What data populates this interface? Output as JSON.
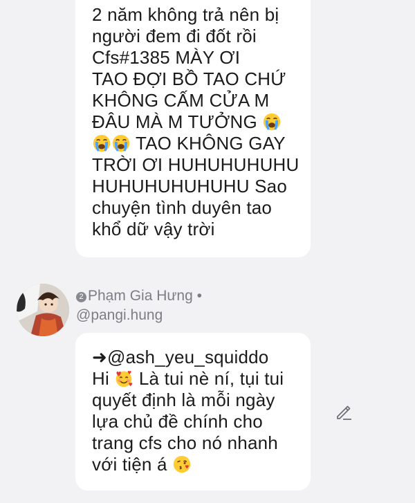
{
  "top_comment": {
    "lines": [
      "2 năm không trả nên bị",
      "người đem đi đốt rồi",
      "Cfs#1385 MÀY ƠI",
      "TAO ĐỢI BỒ TAO CHỨ",
      "KHÔNG CẤM CỬA M",
      "ĐÂU MÀ M TƯỞNG",
      "TAO KHÔNG GAY",
      "TRỜI ƠI HUHUHUHUHU",
      "HUHUHUHUHUHU Sao",
      "chuyện tình duyên tao",
      "khổ dữ vậy trời"
    ]
  },
  "reply": {
    "author_badge": "2",
    "author_name": "Phạm Gia Hưng",
    "author_separator": "•",
    "handle": "@pangi.hung",
    "mention_arrow": "➜",
    "mention": "@ash_yeu_squiddo",
    "line_hi": "Hi",
    "line_hi_rest": "Là tui nè ní, tụi tui",
    "lines": [
      "quyết định là mỗi ngày",
      "lựa chủ đề chính cho",
      "trang cfs cho nó nhanh"
    ],
    "last_line": "với tiện á"
  },
  "icons": {
    "crying": "loudly-crying-face-emoji",
    "hearts": "smiling-face-with-hearts-emoji",
    "kiss": "face-blowing-kiss-emoji",
    "edit": "pencil-edit-icon"
  },
  "colors": {
    "background": "#f2f2f4",
    "bubble": "#ffffff",
    "text": "#1b1b1b",
    "meta": "#7d7d85"
  }
}
